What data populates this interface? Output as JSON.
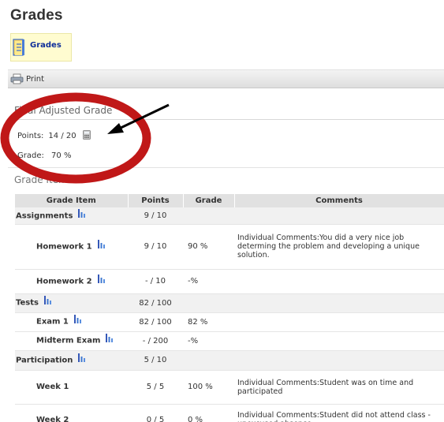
{
  "page": {
    "title": "Grades",
    "nav_link": "Grades",
    "print_label": "Print"
  },
  "final_grade": {
    "heading": "Final Adjusted Grade",
    "points_label": "Points:",
    "points_value": "14 / 20",
    "grade_label": "Grade:",
    "grade_value": "70 %"
  },
  "grade_items_heading": "Grade Items",
  "table": {
    "headers": {
      "item": "Grade Item",
      "points": "Points",
      "grade": "Grade",
      "comments": "Comments"
    },
    "rows": [
      {
        "name": "Assignments",
        "points": "9 / 10",
        "grade": "",
        "comments": ""
      },
      {
        "name": "Homework 1",
        "points": "9 / 10",
        "grade": "90 %",
        "comments": "Individual Comments:You did a very nice job determing the problem and developing a unique solution."
      },
      {
        "name": "Homework 2",
        "points": "- / 10",
        "grade": "-%",
        "comments": ""
      },
      {
        "name": "Tests",
        "points": "82 / 100",
        "grade": "",
        "comments": ""
      },
      {
        "name": "Exam 1",
        "points": "82 / 100",
        "grade": "82 %",
        "comments": ""
      },
      {
        "name": "Midterm Exam",
        "points": "- / 200",
        "grade": "-%",
        "comments": ""
      },
      {
        "name": "Participation",
        "points": "5 / 10",
        "grade": "",
        "comments": ""
      },
      {
        "name": "Week 1",
        "points": "5 / 5",
        "grade": "100 %",
        "comments": "Individual Comments:Student was on time and participated"
      },
      {
        "name": "Week 2",
        "points": "0 / 5",
        "grade": "0 %",
        "comments": "Individual Comments:Student did not attend class - unexcused absence."
      }
    ]
  },
  "icons": {
    "nav": "grades-book-icon",
    "print": "printer-icon",
    "calc": "calculator-icon",
    "stats": "bar-chart-icon"
  },
  "colors": {
    "link": "#0f2f9a",
    "nav_highlight": "#fffcd0",
    "header_bg": "#e1e1e1",
    "annotation_circle": "#c01818",
    "arrow": "#000000"
  }
}
